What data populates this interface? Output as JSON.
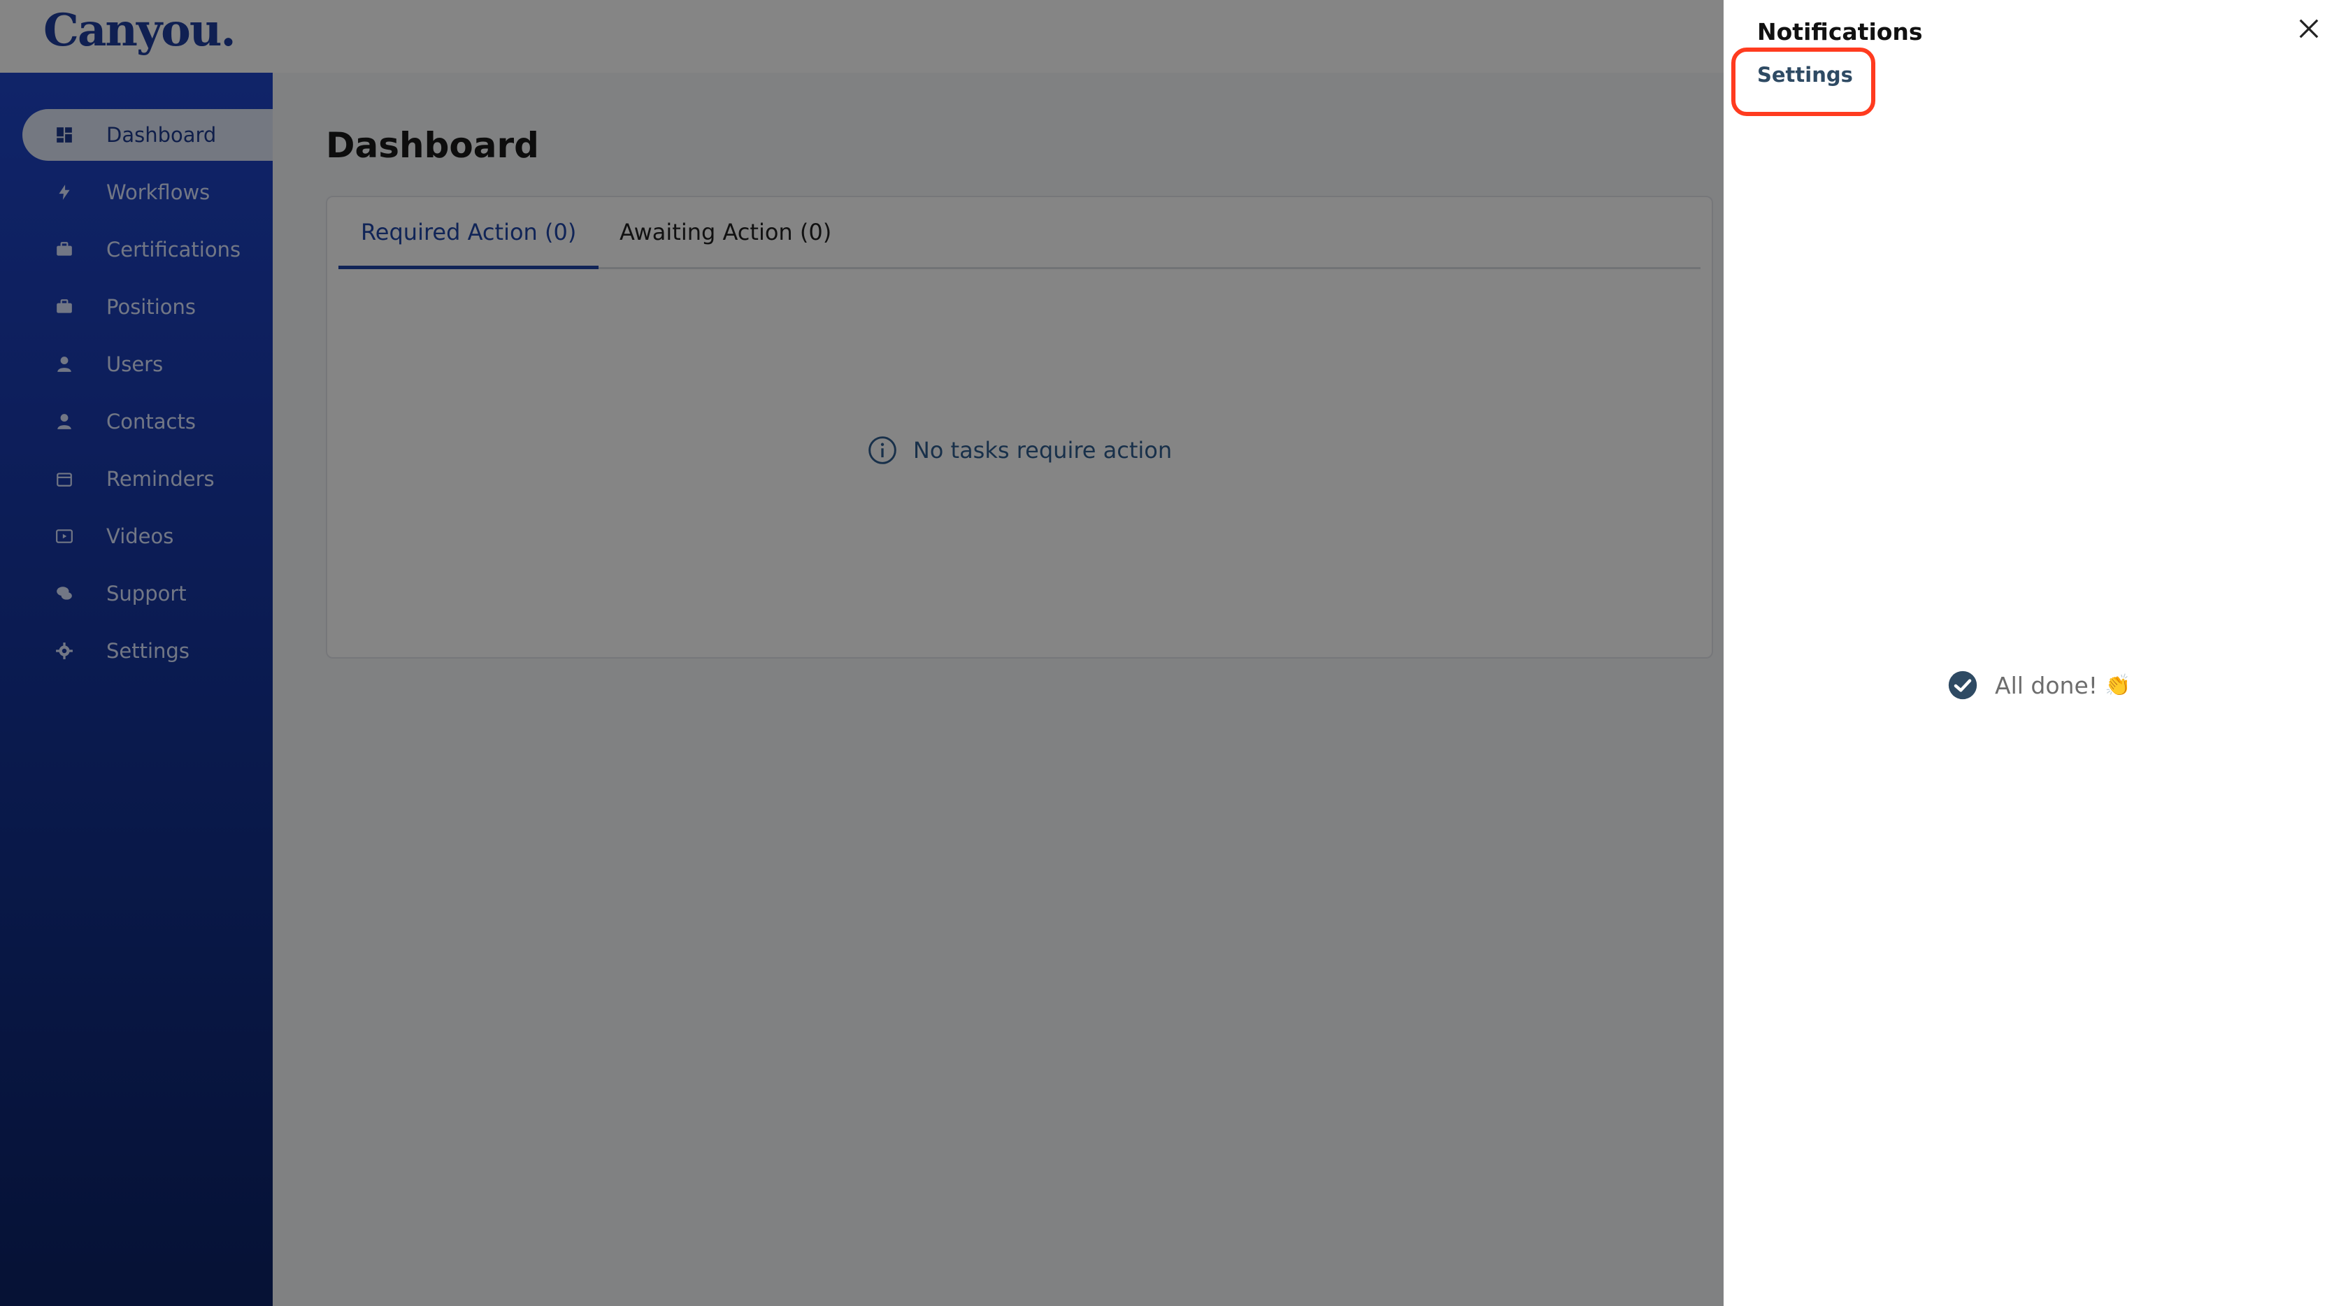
{
  "app": {
    "logo_text": "Canyou."
  },
  "sidebar": {
    "items": [
      {
        "label": "Dashboard",
        "icon": "dashboard-icon",
        "active": true
      },
      {
        "label": "Workflows",
        "icon": "bolt-icon"
      },
      {
        "label": "Certifications",
        "icon": "briefcase-icon"
      },
      {
        "label": "Positions",
        "icon": "briefcase-icon"
      },
      {
        "label": "Users",
        "icon": "user-icon"
      },
      {
        "label": "Contacts",
        "icon": "user-icon"
      },
      {
        "label": "Reminders",
        "icon": "calendar-icon"
      },
      {
        "label": "Videos",
        "icon": "video-icon"
      },
      {
        "label": "Support",
        "icon": "chat-icon"
      },
      {
        "label": "Settings",
        "icon": "gear-icon"
      }
    ]
  },
  "main": {
    "title": "Dashboard",
    "tabs": [
      {
        "label": "Required Action (0)",
        "active": true
      },
      {
        "label": "Awaiting Action (0)"
      }
    ],
    "empty_message": "No tasks require action"
  },
  "drawer": {
    "title": "Notifications",
    "settings_link": "Settings",
    "all_done_text": "All done!",
    "all_done_emoji": "👏"
  },
  "colors": {
    "accent": "#1f45a8",
    "sidebar_top": "#1f45c9",
    "sidebar_bottom": "#0c2366",
    "highlight": "#ff3b1f"
  }
}
